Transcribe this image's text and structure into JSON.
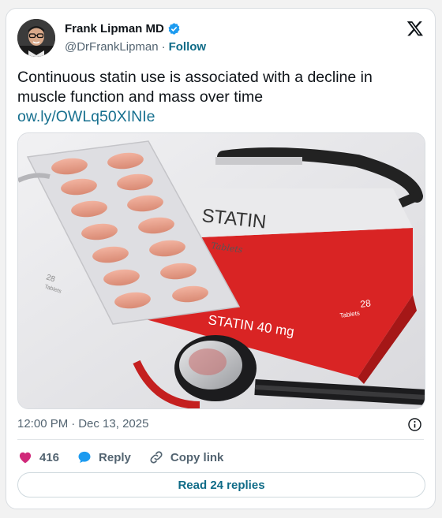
{
  "author": {
    "display_name": "Frank Lipman MD",
    "handle": "@DrFrankLipman",
    "separator": "·",
    "follow_label": "Follow"
  },
  "tweet": {
    "text": "Continuous statin use is associated with a decline in muscle function and mass over time",
    "link": "ow.ly/OWLq50XINIe"
  },
  "media": {
    "box_brand": "STATIN",
    "box_subtitle": "Tablets",
    "box_dose": "STATIN 40 mg",
    "box_count_number": "28",
    "box_count_label": "Tablets",
    "blister_count_number": "28",
    "blister_count_label": "Tablets"
  },
  "meta": {
    "time": "12:00 PM",
    "separator": "·",
    "date": "Dec 13, 2025"
  },
  "actions": {
    "like_count": "416",
    "reply_label": "Reply",
    "copy_label": "Copy link",
    "read_replies_label": "Read 24 replies"
  },
  "colors": {
    "accent": "#1d9bf0",
    "link": "#17708f",
    "like": "#d0297a",
    "box_red": "#e02a2a"
  },
  "icons": [
    "verified-badge-icon",
    "x-logo-icon",
    "info-icon",
    "heart-icon",
    "reply-bubble-icon",
    "link-icon"
  ]
}
